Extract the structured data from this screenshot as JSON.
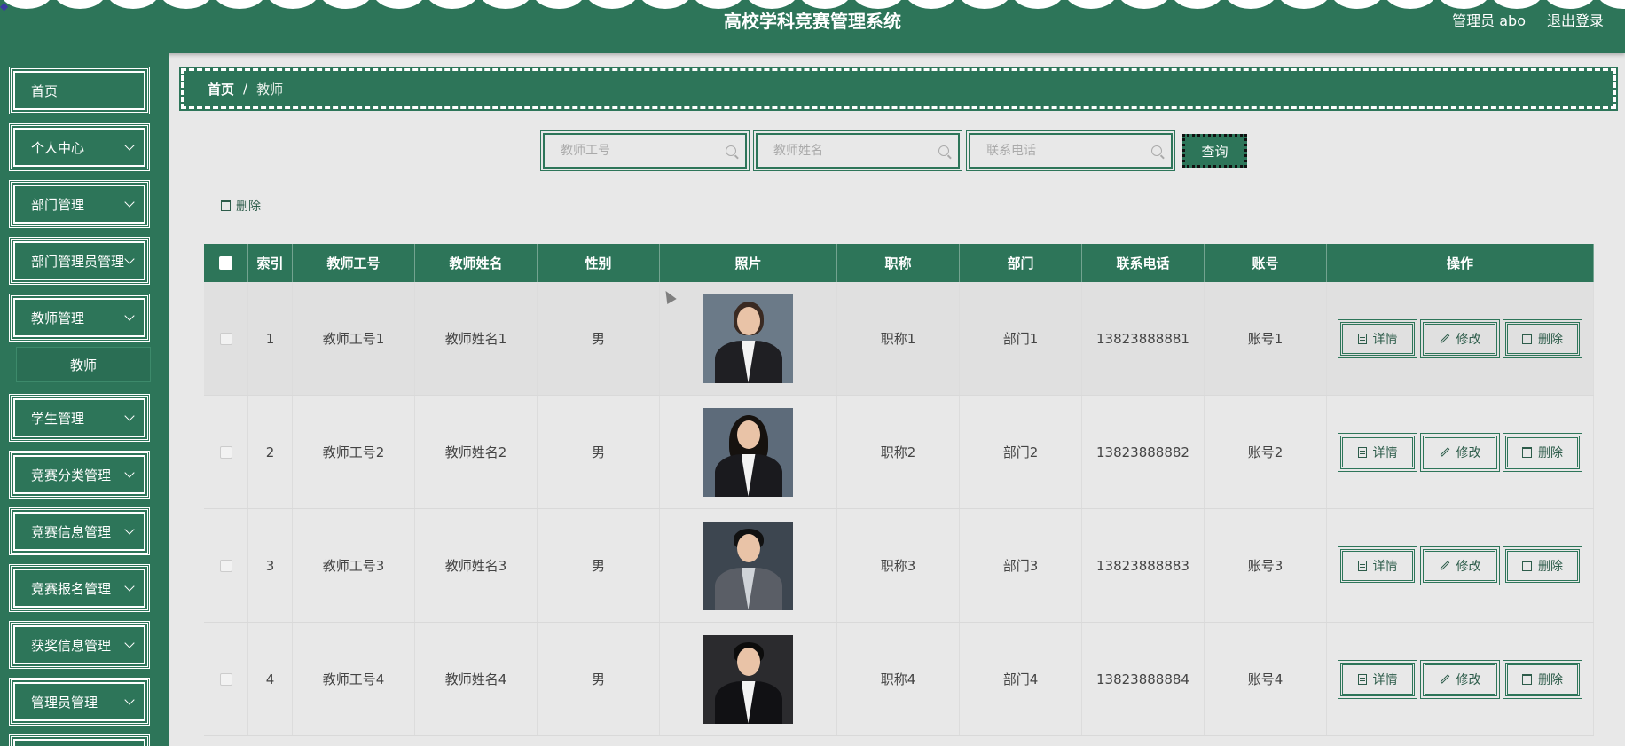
{
  "header": {
    "title": "高校学科竞赛管理系统",
    "user": "管理员 abo",
    "logout": "退出登录"
  },
  "sidebar": {
    "items": [
      {
        "label": "首页"
      },
      {
        "label": "个人中心"
      },
      {
        "label": "部门管理"
      },
      {
        "label": "部门管理员管理"
      },
      {
        "label": "教师管理"
      },
      {
        "label": "教师",
        "sub": true
      },
      {
        "label": "学生管理"
      },
      {
        "label": "竞赛分类管理"
      },
      {
        "label": "竞赛信息管理"
      },
      {
        "label": "竞赛报名管理"
      },
      {
        "label": "获奖信息管理"
      },
      {
        "label": "管理员管理"
      }
    ]
  },
  "breadcrumb": {
    "home": "首页",
    "separator": "/",
    "current": "教师"
  },
  "search": {
    "teacher_no_placeholder": "教师工号",
    "teacher_name_placeholder": "教师姓名",
    "phone_placeholder": "联系电话",
    "query_label": "查询"
  },
  "toolbar": {
    "delete_label": "删除"
  },
  "table": {
    "columns": [
      "索引",
      "教师工号",
      "教师姓名",
      "性别",
      "照片",
      "职称",
      "部门",
      "联系电话",
      "账号",
      "操作"
    ],
    "rows": [
      {
        "index": "1",
        "teacher_no": "教师工号1",
        "teacher_name": "教师姓名1",
        "gender": "男",
        "title": "职称1",
        "dept": "部门1",
        "phone": "13823888881",
        "account": "账号1"
      },
      {
        "index": "2",
        "teacher_no": "教师工号2",
        "teacher_name": "教师姓名2",
        "gender": "男",
        "title": "职称2",
        "dept": "部门2",
        "phone": "13823888882",
        "account": "账号2"
      },
      {
        "index": "3",
        "teacher_no": "教师工号3",
        "teacher_name": "教师姓名3",
        "gender": "男",
        "title": "职称3",
        "dept": "部门3",
        "phone": "13823888883",
        "account": "账号3"
      },
      {
        "index": "4",
        "teacher_no": "教师工号4",
        "teacher_name": "教师姓名4",
        "gender": "男",
        "title": "职称4",
        "dept": "部门4",
        "phone": "13823888884",
        "account": "账号4"
      }
    ],
    "actions": {
      "detail": "详情",
      "edit": "修改",
      "delete": "删除"
    }
  },
  "colors": {
    "primary": "#2d7559",
    "page_bg": "#e8e8e8"
  }
}
